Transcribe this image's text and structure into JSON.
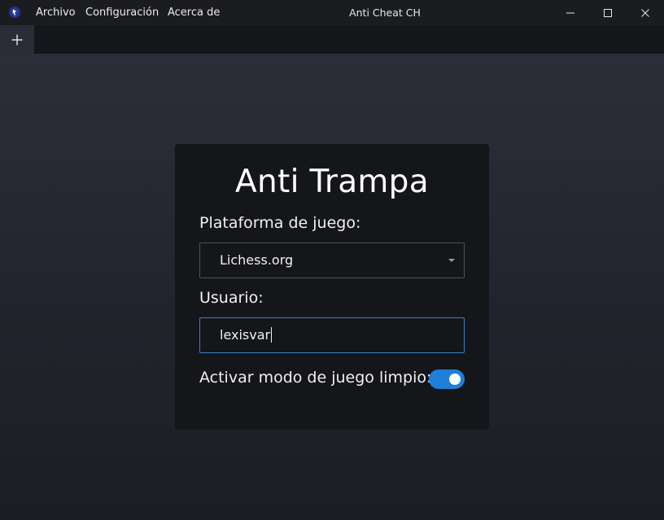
{
  "window": {
    "title": "Anti Cheat CH",
    "app_icon": "app-logo-icon",
    "controls": [
      "minimize-icon",
      "maximize-icon",
      "close-icon"
    ]
  },
  "menu": {
    "items": [
      {
        "label": "Archivo"
      },
      {
        "label": "Configuración"
      },
      {
        "label": "Acerca de"
      }
    ]
  },
  "tabs": {
    "new_tab_icon": "plus-icon"
  },
  "form": {
    "title": "Anti Trampa",
    "platform_label": "Plataforma de juego:",
    "platform_value": "Lichess.org",
    "user_label": "Usuario:",
    "user_value": "lexisvar",
    "fair_play_label": "Activar modo de juego limpio:",
    "fair_play_enabled": true
  },
  "colors": {
    "accent": "#1f7fd8",
    "focus_border": "#3a7fd6",
    "card_bg": "#15161a",
    "titlebar_bg": "#1b1c20"
  }
}
